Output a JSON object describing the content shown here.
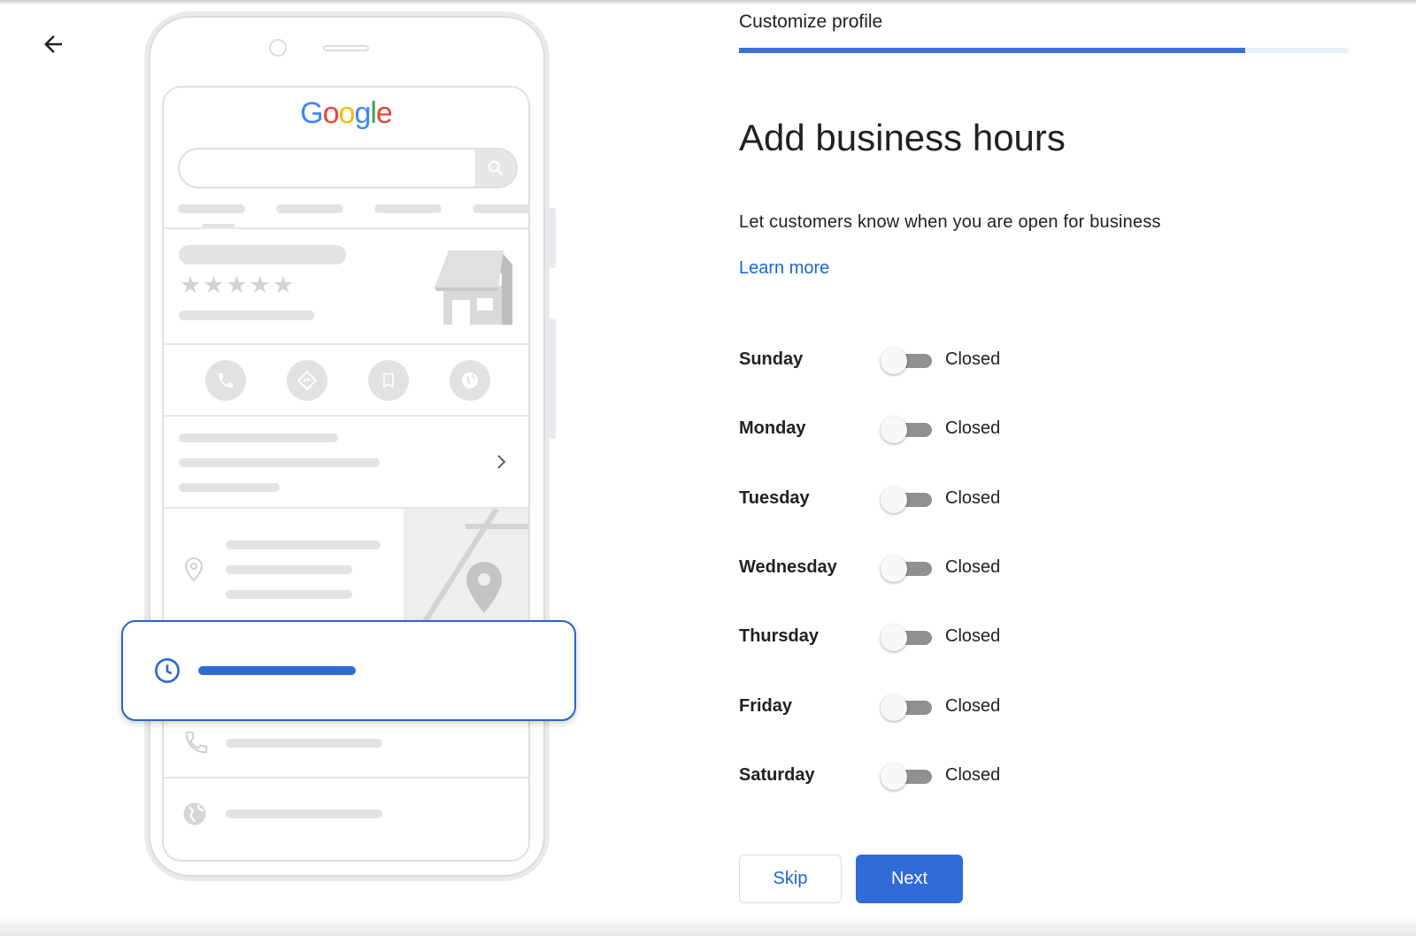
{
  "header": {
    "step_title": "Customize profile",
    "progress_fraction": 0.83
  },
  "main": {
    "title": "Add business hours",
    "subtitle": "Let customers know when you are open for business",
    "learn_more": "Learn more"
  },
  "days": [
    {
      "name": "Sunday",
      "status": "Closed",
      "open": false
    },
    {
      "name": "Monday",
      "status": "Closed",
      "open": false
    },
    {
      "name": "Tuesday",
      "status": "Closed",
      "open": false
    },
    {
      "name": "Wednesday",
      "status": "Closed",
      "open": false
    },
    {
      "name": "Thursday",
      "status": "Closed",
      "open": false
    },
    {
      "name": "Friday",
      "status": "Closed",
      "open": false
    },
    {
      "name": "Saturday",
      "status": "Closed",
      "open": false
    }
  ],
  "buttons": {
    "skip": "Skip",
    "next": "Next"
  },
  "illustration": {
    "logo": "Google",
    "rating_stars": "★★★★★"
  },
  "colors": {
    "accent": "#1a73e8",
    "progress": "#3c70d8",
    "toggle_off_track": "#909090"
  }
}
